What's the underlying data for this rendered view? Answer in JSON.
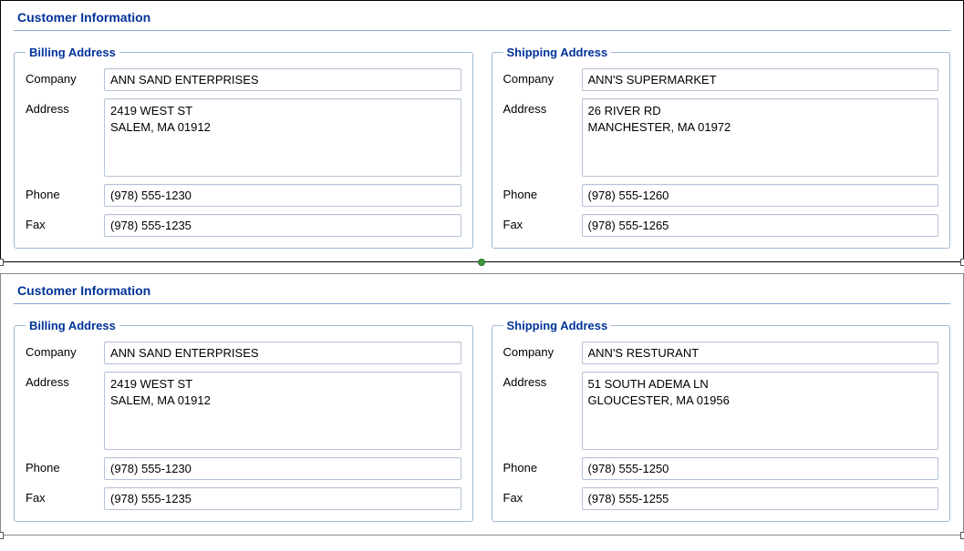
{
  "panels": [
    {
      "title": "Customer Information",
      "billing": {
        "legend": "Billing Address",
        "companyLabel": "Company",
        "company": "ANN SAND ENTERPRISES",
        "addressLabel": "Address",
        "address": "2419 WEST ST\nSALEM, MA 01912",
        "phoneLabel": "Phone",
        "phone": "(978) 555-1230",
        "faxLabel": "Fax",
        "fax": "(978) 555-1235"
      },
      "shipping": {
        "legend": "Shipping Address",
        "companyLabel": "Company",
        "company": "ANN'S SUPERMARKET",
        "addressLabel": "Address",
        "address": "26 RIVER RD\nMANCHESTER, MA 01972",
        "phoneLabel": "Phone",
        "phone": "(978) 555-1260",
        "faxLabel": "Fax",
        "fax": "(978) 555-1265"
      }
    },
    {
      "title": "Customer Information",
      "billing": {
        "legend": "Billing Address",
        "companyLabel": "Company",
        "company": "ANN SAND ENTERPRISES",
        "addressLabel": "Address",
        "address": "2419 WEST ST\nSALEM, MA 01912",
        "phoneLabel": "Phone",
        "phone": "(978) 555-1230",
        "faxLabel": "Fax",
        "fax": "(978) 555-1235"
      },
      "shipping": {
        "legend": "Shipping Address",
        "companyLabel": "Company",
        "company": "ANN'S RESTURANT",
        "addressLabel": "Address",
        "address": "51 SOUTH ADEMA LN\nGLOUCESTER, MA 01956",
        "phoneLabel": "Phone",
        "phone": "(978) 555-1250",
        "faxLabel": "Fax",
        "fax": "(978) 555-1255"
      }
    }
  ]
}
